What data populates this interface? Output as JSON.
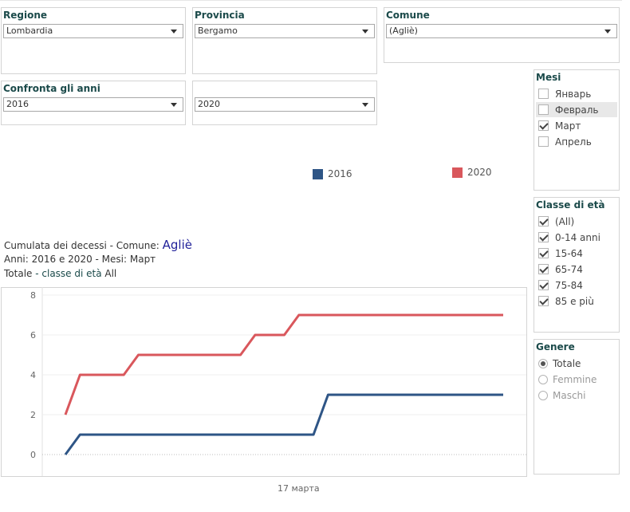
{
  "filters": {
    "regione": {
      "title": "Regione",
      "value": "Lombardia"
    },
    "provincia": {
      "title": "Provincia",
      "value": "Bergamo"
    },
    "comune": {
      "title": "Comune",
      "value": "(Agliè)"
    },
    "confronta": {
      "title": "Confronta gli anni",
      "value1": "2016",
      "value2": "2020"
    }
  },
  "mesi": {
    "title": "Mesi",
    "items": [
      {
        "label": "Январь",
        "checked": false,
        "highlighted": false
      },
      {
        "label": "Февраль",
        "checked": false,
        "highlighted": true
      },
      {
        "label": "Март",
        "checked": true,
        "highlighted": false
      },
      {
        "label": "Апрель",
        "checked": false,
        "highlighted": false
      }
    ]
  },
  "classe": {
    "title": "Classe di età",
    "items": [
      {
        "label": "(All)",
        "checked": true
      },
      {
        "label": "0-14 anni",
        "checked": true
      },
      {
        "label": "15-64",
        "checked": true
      },
      {
        "label": "65-74",
        "checked": true
      },
      {
        "label": "75-84",
        "checked": true
      },
      {
        "label": "85 e più",
        "checked": true
      }
    ]
  },
  "genere": {
    "title": "Genere",
    "items": [
      {
        "label": "Totale",
        "checked": true
      },
      {
        "label": "Femmine",
        "checked": false
      },
      {
        "label": "Maschi",
        "checked": false
      }
    ]
  },
  "legend": [
    {
      "label": "2016",
      "color": "#2e5586"
    },
    {
      "label": "2020",
      "color": "#d9575c"
    }
  ],
  "chart_title": {
    "line1_prefix": "Cumulata dei decessi -  Comune: ",
    "line1_value": "Agliè",
    "line2_prefix": "Anni: ",
    "line2_years": "2016 e 2020",
    "line2_sep": "   -   Mesi: ",
    "line2_month": "Март",
    "line3_prefix": "Totale",
    "line3_mid": " - classe di età ",
    "line3_value": "All"
  },
  "chart_data": {
    "type": "line",
    "x": [
      1,
      2,
      3,
      4,
      5,
      6,
      7,
      8,
      9,
      10,
      11,
      12,
      13,
      14,
      15,
      16,
      17,
      18,
      19,
      20,
      21,
      22,
      23,
      24,
      25,
      26,
      27,
      28,
      29,
      30,
      31
    ],
    "series": [
      {
        "name": "2016",
        "color": "#2e5586",
        "values": [
          0,
          1,
          1,
          1,
          1,
          1,
          1,
          1,
          1,
          1,
          1,
          1,
          1,
          1,
          1,
          1,
          1,
          1,
          3,
          3,
          3,
          3,
          3,
          3,
          3,
          3,
          3,
          3,
          3,
          3,
          3
        ]
      },
      {
        "name": "2020",
        "color": "#d9575c",
        "values": [
          2,
          4,
          4,
          4,
          4,
          5,
          5,
          5,
          5,
          5,
          5,
          5,
          5,
          6,
          6,
          6,
          7,
          7,
          7,
          7,
          7,
          7,
          7,
          7,
          7,
          7,
          7,
          7,
          7,
          7,
          7
        ]
      }
    ],
    "ylim": [
      0,
      8
    ],
    "yticks": [
      0,
      2,
      4,
      6,
      8
    ],
    "xlabel": "17 марта",
    "grid": true
  }
}
